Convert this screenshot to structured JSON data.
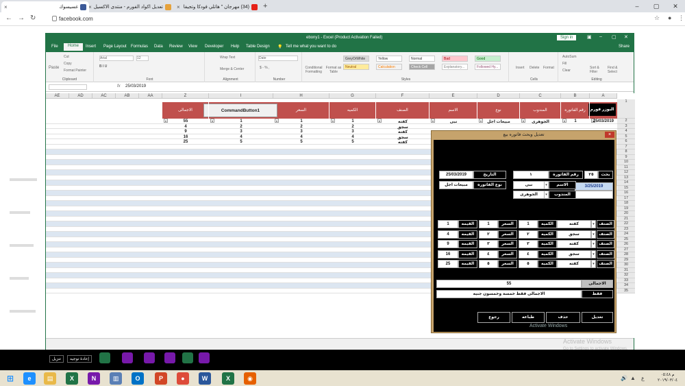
{
  "browser": {
    "tabs": [
      {
        "label": "غسيسوك",
        "color": "#3b5998",
        "active": true
      },
      {
        "label": "تعديل اكواد الفورم - منتدى الاكسيل",
        "color": "#e6a23c",
        "active": false
      },
      {
        "label": "(34) مهرجان \" هاتلي فودكا وتجيفا",
        "color": "#e62117",
        "active": false
      }
    ],
    "new_tab": "+",
    "url": "facebook.com"
  },
  "excel": {
    "title": "ebony1 - Excel (Product Activation Failed)",
    "sign_in": "Sign in",
    "share": "Share",
    "tell_me": "Tell me what you want to do",
    "menus": [
      "File",
      "Home",
      "Insert",
      "Page Layout",
      "Formulas",
      "Data",
      "Review",
      "View",
      "Developer",
      "Help",
      "Table Design"
    ],
    "ribbon": {
      "paste": "Paste",
      "cut": "Cut",
      "copy": "Copy",
      "format_painter": "Format Painter",
      "font_name": "Arial",
      "font_size": "12",
      "wrap_text": "Wrap Text",
      "merge": "Merge & Center",
      "number_format": "Date",
      "cond_format": "Conditional Formatting",
      "format_table": "Format as Table",
      "styles": [
        {
          "label": "GreyOrWhite",
          "bg": "#d9d9d9",
          "fg": "#333"
        },
        {
          "label": "Yellow",
          "bg": "#ffffff",
          "fg": "#333"
        },
        {
          "label": "Normal",
          "bg": "#ffffff",
          "fg": "#333"
        },
        {
          "label": "Bad",
          "bg": "#ffc7ce",
          "fg": "#9c0006"
        },
        {
          "label": "Good",
          "bg": "#c6efce",
          "fg": "#006100"
        },
        {
          "label": "Neutral",
          "bg": "#ffeb9c",
          "fg": "#9c5700"
        },
        {
          "label": "Calculation",
          "bg": "#f2f2f2",
          "fg": "#fa7d00"
        },
        {
          "label": "Check Cell",
          "bg": "#a5a5a5",
          "fg": "#ffffff"
        },
        {
          "label": "Explanatory...",
          "bg": "#ffffff",
          "fg": "#7f7f7f"
        },
        {
          "label": "Followed Hy...",
          "bg": "#ffffff",
          "fg": "#954f72"
        }
      ],
      "insert": "Insert",
      "delete": "Delete",
      "format": "Format",
      "autosum": "AutoSum",
      "fill": "Fill",
      "clear": "Clear",
      "sort": "Sort & Filter",
      "find": "Find & Select",
      "groups": [
        "Clipboard",
        "Font",
        "Alignment",
        "Number",
        "Styles",
        "Cells",
        "Editing"
      ]
    },
    "formula_bar": {
      "fx": "fx",
      "value": "25/03/2019"
    },
    "columns": [
      "AE",
      "AD",
      "AC",
      "AB",
      "AA",
      "Z",
      "I",
      "H",
      "G",
      "F",
      "E",
      "D",
      "C",
      "B",
      "A"
    ],
    "header_labels": {
      "Z": "الاجمالى",
      "H": "السعر",
      "G": "الكميه",
      "F": "الصنف",
      "E": "الاسم",
      "D": "نوع",
      "C": "المندوب",
      "B": "رقم الفاتوره",
      "A": "البوزر فورم"
    },
    "command_button": "CommandButton1",
    "data_rows": [
      {
        "Z": "55",
        "I": "1",
        "H": "1",
        "G": "1",
        "F": "كفته",
        "E": "نبى",
        "D": "مبيعات اجل",
        "C": "الجوهرى",
        "B": "1",
        "A": "25/03/2019"
      },
      {
        "Z": "4",
        "I": "2",
        "H": "2",
        "G": "2",
        "F": "سجق"
      },
      {
        "Z": "9",
        "I": "3",
        "H": "3",
        "G": "3",
        "F": "كفته"
      },
      {
        "Z": "16",
        "I": "4",
        "H": "4",
        "G": "4",
        "F": "سجق"
      },
      {
        "Z": "25",
        "I": "5",
        "H": "5",
        "G": "5",
        "F": "كفته"
      }
    ],
    "row_numbers": [
      "1",
      "2",
      "3",
      "4",
      "5",
      "6",
      "7",
      "8",
      "9",
      "10",
      "11",
      "12",
      "13",
      "14",
      "15",
      "16",
      "17",
      "18",
      "19",
      "20",
      "21",
      "22",
      "23",
      "24",
      "25",
      "26",
      "27",
      "28",
      "29",
      "30",
      "31",
      "32",
      "33",
      "34",
      "35"
    ]
  },
  "userform": {
    "title": "تعديل وبحث فاتوره بيع",
    "close": "×",
    "search_label": "بحث",
    "search_value": "٢٥",
    "invoice_no_label": "رقم الفاتوره",
    "invoice_no_value": "١",
    "date_label": "التاريخ",
    "date_value": "25/03/2019",
    "date_picker": "3/25/2019",
    "name_label": "الاسم",
    "name_value": "نبى",
    "inv_type_label": "نوع الفاتوره",
    "inv_type_value": "مبيعات اجل",
    "rep_label": "المندوب",
    "rep_value": "الجوهرى",
    "item_label": "الصنف",
    "qty_label": "الكميه",
    "price_label": "السعر",
    "value_label": "القيمه",
    "lines": [
      {
        "item": "كفته",
        "qty": "1",
        "price": "1",
        "value": "1"
      },
      {
        "item": "سجق",
        "qty": "٢",
        "price": "٢",
        "value": "4"
      },
      {
        "item": "كفته",
        "qty": "٣",
        "price": "٣",
        "value": "9"
      },
      {
        "item": "سجق",
        "qty": "٤",
        "price": "٤",
        "value": "16"
      },
      {
        "item": "كفته",
        "qty": "٥",
        "price": "٥",
        "value": "25"
      }
    ],
    "total_label": "الاجمالى",
    "total_value": "55",
    "words_label": "فقط",
    "words_value": "الاجمالى فقط خمسة وخمسون جنيه",
    "buttons": [
      "تعديل",
      "حذف",
      "طباعه",
      "رجوع"
    ],
    "activate": "Activate Windows"
  },
  "activate_overlay": {
    "title": "Activate Windows",
    "sub": "Go to Settings to activate Windows."
  },
  "bottom": {
    "btn_left": "تنزيل",
    "btn_right": "إعادة توجيه"
  },
  "taskbar": {
    "apps": [
      {
        "glyph": "e",
        "color": "#1e90ff"
      },
      {
        "glyph": "▤",
        "color": "#e9b949"
      },
      {
        "glyph": "X",
        "color": "#217346"
      },
      {
        "glyph": "N",
        "color": "#7719aa"
      },
      {
        "glyph": "▥",
        "color": "#5a7fb5"
      },
      {
        "glyph": "O",
        "color": "#0072c6"
      },
      {
        "glyph": "P",
        "color": "#d24726"
      },
      {
        "glyph": "●",
        "color": "#dd4b39"
      },
      {
        "glyph": "W",
        "color": "#2b579a"
      },
      {
        "glyph": "X",
        "color": "#217346"
      },
      {
        "glyph": "◉",
        "color": "#e66000"
      }
    ],
    "time": "م ٠٥:٤٨",
    "date": "٢٠١٩/٠٣/٠٤",
    "lang": "ع"
  }
}
